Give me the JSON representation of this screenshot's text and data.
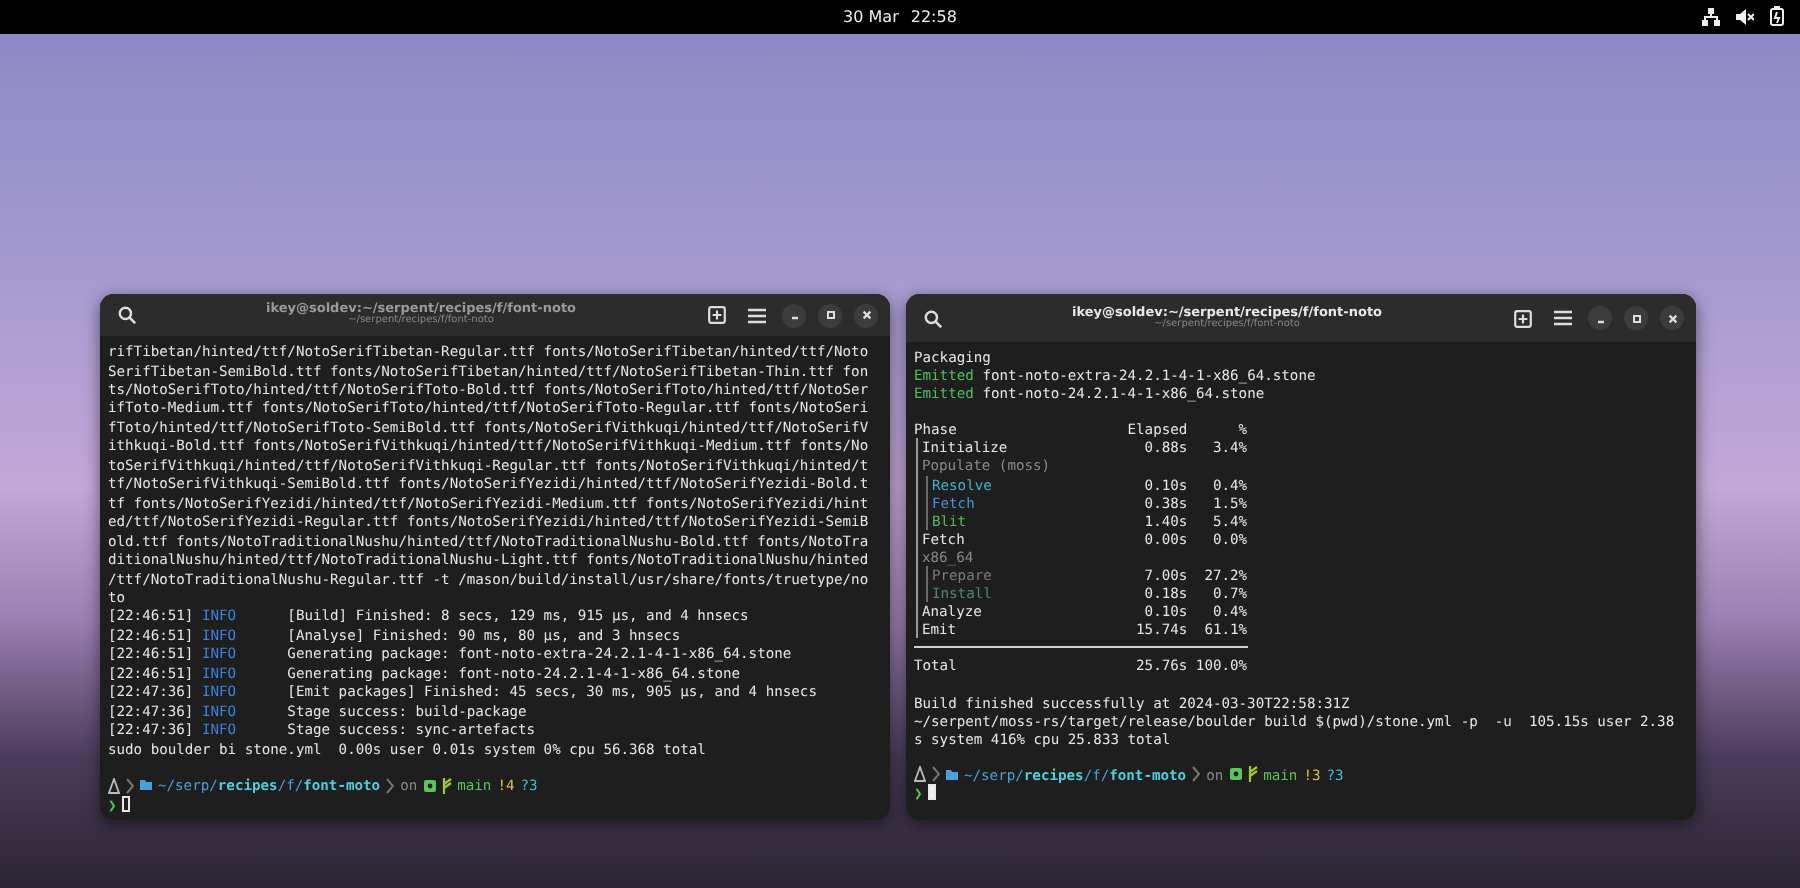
{
  "top_bar": {
    "date": "30 Mar",
    "time": "22:58"
  },
  "windows": [
    {
      "title": "ikey@soldev:~/serpent/recipes/f/font-noto",
      "subtitle": "~/serpent/recipes/f/font-noto",
      "blocks": [
        {
          "kind": "text",
          "lines": [
            "rifTibetan/hinted/ttf/NotoSerifTibetan-Regular.ttf fonts/NotoSerifTibetan/hinted/ttf/Noto",
            "SerifTibetan-SemiBold.ttf fonts/NotoSerifTibetan/hinted/ttf/NotoSerifTibetan-Thin.ttf fon",
            "ts/NotoSerifToto/hinted/ttf/NotoSerifToto-Bold.ttf fonts/NotoSerifToto/hinted/ttf/NotoSer",
            "ifToto-Medium.ttf fonts/NotoSerifToto/hinted/ttf/NotoSerifToto-Regular.ttf fonts/NotoSeri",
            "fToto/hinted/ttf/NotoSerifToto-SemiBold.ttf fonts/NotoSerifVithkuqi/hinted/ttf/NotoSerifV",
            "ithkuqi-Bold.ttf fonts/NotoSerifVithkuqi/hinted/ttf/NotoSerifVithkuqi-Medium.ttf fonts/No",
            "toSerifVithkuqi/hinted/ttf/NotoSerifVithkuqi-Regular.ttf fonts/NotoSerifVithkuqi/hinted/t",
            "tf/NotoSerifVithkuqi-SemiBold.ttf fonts/NotoSerifYezidi/hinted/ttf/NotoSerifYezidi-Bold.t",
            "tf fonts/NotoSerifYezidi/hinted/ttf/NotoSerifYezidi-Medium.ttf fonts/NotoSerifYezidi/hint",
            "ed/ttf/NotoSerifYezidi-Regular.ttf fonts/NotoSerifYezidi/hinted/ttf/NotoSerifYezidi-SemiB",
            "old.ttf fonts/NotoTraditionalNushu/hinted/ttf/NotoTraditionalNushu-Bold.ttf fonts/NotoTra",
            "ditionalNushu/hinted/ttf/NotoTraditionalNushu-Light.ttf fonts/NotoTraditionalNushu/hinted",
            "/ttf/NotoTraditionalNushu-Regular.ttf -t /mason/build/install/usr/share/fonts/truetype/no",
            "to"
          ]
        },
        {
          "kind": "log",
          "entries": [
            {
              "time": "[22:46:51]",
              "level": "INFO",
              "message": "[Build] Finished: 8 secs, 129 ms, 915 μs, and 4 hnsecs"
            },
            {
              "time": "[22:46:51]",
              "level": "INFO",
              "message": "[Analyse] Finished: 90 ms, 80 μs, and 3 hnsecs"
            },
            {
              "time": "[22:46:51]",
              "level": "INFO",
              "message": "Generating package: font-noto-extra-24.2.1-4-1-x86_64.stone"
            },
            {
              "time": "[22:46:51]",
              "level": "INFO",
              "message": "Generating package: font-noto-24.2.1-4-1-x86_64.stone"
            },
            {
              "time": "[22:47:36]",
              "level": "INFO",
              "message": "[Emit packages] Finished: 45 secs, 30 ms, 905 μs, and 4 hnsecs"
            },
            {
              "time": "[22:47:36]",
              "level": "INFO",
              "message": "Stage success: build-package"
            },
            {
              "time": "[22:47:36]",
              "level": "INFO",
              "message": "Stage success: sync-artefacts"
            }
          ]
        },
        {
          "kind": "text",
          "lines": [
            "sudo boulder bi stone.yml  0.00s user 0.01s system 0% cpu 56.368 total"
          ]
        },
        {
          "kind": "prompt",
          "path": "~/serp/**recipes**/f/**font-moto**",
          "vcs": "on",
          "branch": "main",
          "status": [
            {
              "text": "!4",
              "kind": "modified"
            },
            {
              "text": "?3",
              "kind": "untracked"
            }
          ],
          "symbol": "❯",
          "cursor_filled": false
        }
      ]
    },
    {
      "title": "ikey@soldev:~/serpent/recipes/f/font-noto",
      "subtitle": "~/serpent/recipes/f/font-noto",
      "blocks": [
        {
          "kind": "text",
          "lines": [
            "Packaging"
          ]
        },
        {
          "kind": "emitted",
          "entries": [
            {
              "label": "Emitted",
              "file": "font-noto-extra-24.2.1-4-1-x86_64.stone"
            },
            {
              "label": "Emitted",
              "file": "font-noto-24.2.1-4-1-x86_64.stone"
            }
          ]
        },
        {
          "kind": "phase_table",
          "header": [
            "Phase",
            "Elapsed",
            "%"
          ],
          "rows": [
            {
              "name": "Initialize",
              "elapsed": "0.88s",
              "percent": "3.4%"
            },
            {
              "name": "Populate (moss)",
              "children": [
                {
                  "name": "Resolve",
                  "elapsed": "0.10s",
                  "percent": "0.4%",
                  "color": "#3fb5c9"
                },
                {
                  "name": "Fetch",
                  "elapsed": "0.38s",
                  "percent": "1.5%",
                  "color": "#4a8fd8"
                },
                {
                  "name": "Blit",
                  "elapsed": "1.40s",
                  "percent": "5.4%",
                  "color": "#5cb85c"
                }
              ]
            },
            {
              "name": "Fetch",
              "elapsed": "0.00s",
              "percent": "0.0%"
            },
            {
              "name": "x86_64",
              "children": [
                {
                  "name": "Prepare",
                  "elapsed": "7.00s",
                  "percent": "27.2%",
                  "color": "#7a7a7a"
                },
                {
                  "name": "Install",
                  "elapsed": "0.18s",
                  "percent": "0.7%",
                  "color": "#4f8a6a"
                }
              ]
            },
            {
              "name": "Analyze",
              "elapsed": "0.10s",
              "percent": "0.4%"
            },
            {
              "name": "Emit",
              "elapsed": "15.74s",
              "percent": "61.1%"
            }
          ],
          "total": {
            "name": "Total",
            "elapsed": "25.76s",
            "percent": "100.0%"
          }
        },
        {
          "kind": "text",
          "lines": [
            "Build finished successfully at 2024-03-30T22:58:31Z",
            "~/serpent/moss-rs/target/release/boulder build $(pwd)/stone.yml -p  -u  105.15s user 2.38",
            "s system 416% cpu 25.833 total"
          ]
        },
        {
          "kind": "prompt",
          "path": "~/serp/**recipes**/f/**font-moto**",
          "vcs": "on",
          "branch": "main",
          "status": [
            {
              "text": "!3",
              "kind": "modified"
            },
            {
              "text": "?3",
              "kind": "untracked"
            }
          ],
          "symbol": "❯",
          "cursor_filled": true
        }
      ]
    }
  ]
}
